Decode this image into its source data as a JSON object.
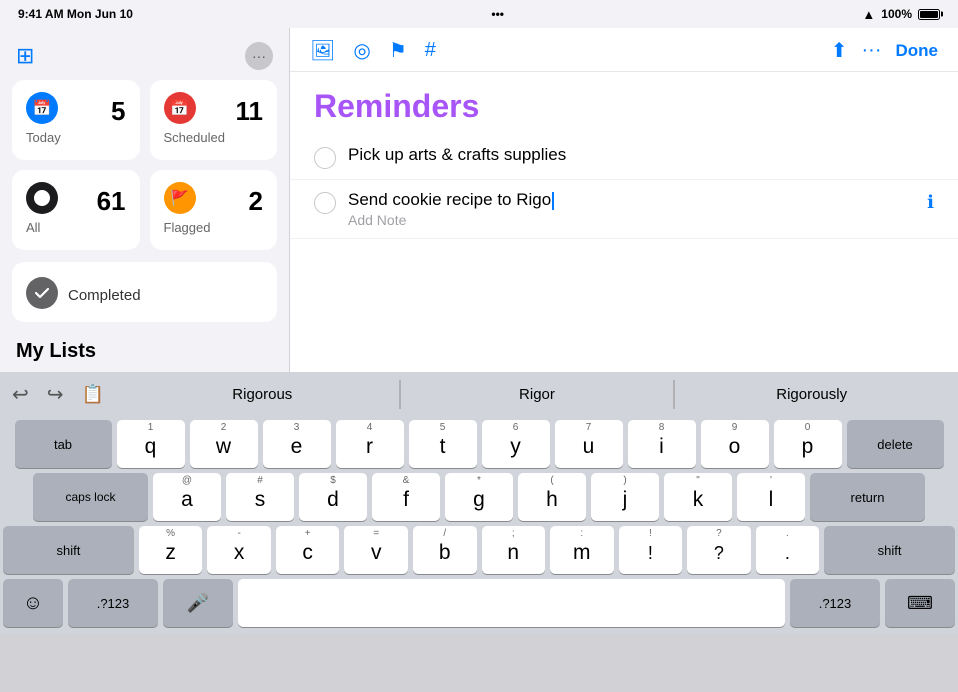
{
  "status_bar": {
    "time": "9:41 AM",
    "date": "Mon Jun 10",
    "dots": "•••",
    "wifi": "WiFi",
    "battery_pct": "100%"
  },
  "sidebar": {
    "panel_icon": "⊞",
    "ellipsis": "···",
    "smart_lists": [
      {
        "id": "today",
        "label": "Today",
        "count": "5",
        "icon": "📅",
        "icon_color": "#007aff"
      },
      {
        "id": "scheduled",
        "label": "Scheduled",
        "count": "11",
        "icon": "📅",
        "icon_color": "#e53935"
      },
      {
        "id": "all",
        "label": "All",
        "count": "61",
        "icon": "⚫",
        "icon_color": "#1c1c1e"
      },
      {
        "id": "flagged",
        "label": "Flagged",
        "count": "2",
        "icon": "🚩",
        "icon_color": "#ff9500"
      }
    ],
    "completed": {
      "label": "Completed",
      "icon": "✓"
    },
    "my_lists_label": "My Lists"
  },
  "toolbar": {
    "icons": [
      "🖥",
      "◎",
      "⚑",
      "#"
    ],
    "share_icon": "⬆",
    "more_icon": "···",
    "done_label": "Done"
  },
  "reminders": {
    "title": "Reminders",
    "items": [
      {
        "id": "item1",
        "text": "Pick up arts & crafts supplies",
        "has_info": false
      },
      {
        "id": "item2",
        "text": "Send cookie recipe to Rigo",
        "note": "Add Note",
        "has_info": true
      }
    ]
  },
  "keyboard": {
    "autocorrect": {
      "suggestions": [
        "Rigorous",
        "Rigor",
        "Rigorously"
      ]
    },
    "rows": [
      {
        "id": "row1",
        "keys": [
          {
            "id": "tab",
            "label": "tab",
            "type": "modifier"
          },
          {
            "id": "q",
            "num": "1",
            "label": "q",
            "type": "letter"
          },
          {
            "id": "w",
            "num": "2",
            "label": "w",
            "type": "letter"
          },
          {
            "id": "e",
            "num": "3",
            "label": "e",
            "type": "letter"
          },
          {
            "id": "r",
            "num": "4",
            "label": "r",
            "type": "letter"
          },
          {
            "id": "t",
            "num": "5",
            "label": "t",
            "type": "letter"
          },
          {
            "id": "y",
            "num": "6",
            "label": "y",
            "type": "letter"
          },
          {
            "id": "u",
            "num": "7",
            "label": "u",
            "type": "letter"
          },
          {
            "id": "i",
            "num": "8",
            "label": "i",
            "type": "letter"
          },
          {
            "id": "o",
            "num": "9",
            "label": "o",
            "type": "letter"
          },
          {
            "id": "p",
            "num": "0",
            "label": "p",
            "type": "letter"
          },
          {
            "id": "delete",
            "label": "delete",
            "type": "modifier"
          }
        ]
      },
      {
        "id": "row2",
        "keys": [
          {
            "id": "capslock",
            "label": "caps lock",
            "type": "modifier"
          },
          {
            "id": "a",
            "num": "@",
            "label": "a",
            "type": "letter"
          },
          {
            "id": "s",
            "num": "#",
            "label": "s",
            "type": "letter"
          },
          {
            "id": "d",
            "num": "$",
            "label": "d",
            "type": "letter"
          },
          {
            "id": "f",
            "num": "&",
            "label": "f",
            "type": "letter"
          },
          {
            "id": "g",
            "num": "*",
            "label": "g",
            "type": "letter"
          },
          {
            "id": "h",
            "num": "(",
            "label": "h",
            "type": "letter"
          },
          {
            "id": "j",
            "num": ")",
            "label": "j",
            "type": "letter"
          },
          {
            "id": "k",
            "num": "\"",
            "label": "k",
            "type": "letter"
          },
          {
            "id": "l",
            "num": "'",
            "label": "l",
            "type": "letter"
          },
          {
            "id": "return",
            "label": "return",
            "type": "modifier"
          }
        ]
      },
      {
        "id": "row3",
        "keys": [
          {
            "id": "shift-l",
            "label": "shift",
            "type": "modifier"
          },
          {
            "id": "z",
            "num": "%",
            "label": "z",
            "type": "letter"
          },
          {
            "id": "x",
            "num": "-",
            "label": "x",
            "type": "letter"
          },
          {
            "id": "c",
            "num": "+",
            "label": "c",
            "type": "letter"
          },
          {
            "id": "v",
            "num": "=",
            "label": "v",
            "type": "letter"
          },
          {
            "id": "b",
            "num": "/",
            "label": "b",
            "type": "letter"
          },
          {
            "id": "n",
            "num": ";",
            "label": "n",
            "type": "letter"
          },
          {
            "id": "m",
            "num": ":",
            "label": "m",
            "type": "letter"
          },
          {
            "id": "excl",
            "num": "!",
            "label": "!",
            "type": "letter"
          },
          {
            "id": "quest",
            "num": "?",
            "label": "?",
            "type": "letter"
          },
          {
            "id": "period",
            "num": ".",
            "label": ".",
            "type": "letter"
          },
          {
            "id": "shift-r",
            "label": "shift",
            "type": "modifier"
          }
        ]
      },
      {
        "id": "row4",
        "keys": [
          {
            "id": "emoji",
            "label": "☺",
            "type": "special"
          },
          {
            "id": "numpad",
            "label": ".?123",
            "type": "special"
          },
          {
            "id": "mic",
            "label": "🎤",
            "type": "special"
          },
          {
            "id": "space",
            "label": "",
            "type": "space"
          },
          {
            "id": "numpad2",
            "label": ".?123",
            "type": "special"
          },
          {
            "id": "hide-kb",
            "label": "⌨",
            "type": "special"
          }
        ]
      }
    ]
  }
}
